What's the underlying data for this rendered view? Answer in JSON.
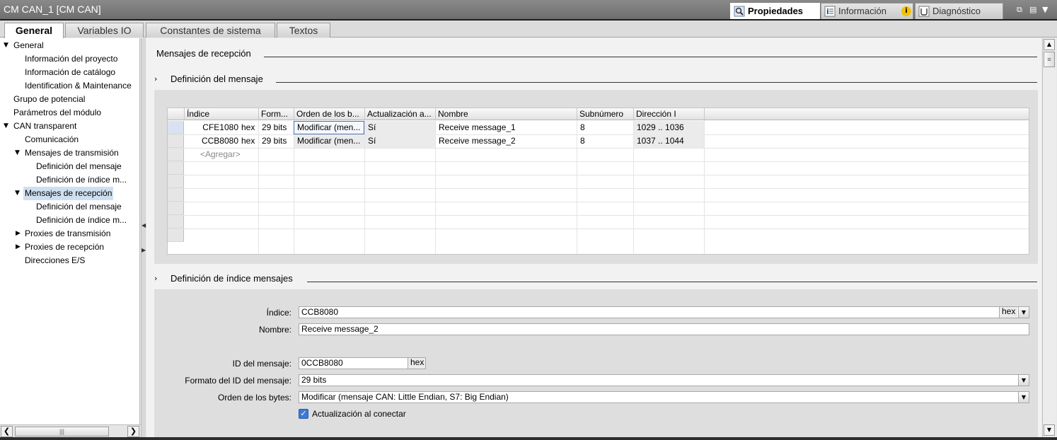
{
  "window": {
    "title": "CM CAN_1 [CM CAN]"
  },
  "inspector_tabs": [
    {
      "label": "Propiedades",
      "icon": "magnifier-icon",
      "active": true
    },
    {
      "label": "Información",
      "icon": "info-list-icon",
      "badge": "i"
    },
    {
      "label": "Diagnóstico",
      "icon": "diagnostics-icon"
    }
  ],
  "tabs": [
    "General",
    "Variables IO",
    "Constantes de sistema",
    "Textos"
  ],
  "active_tab": "General",
  "nav": [
    {
      "label": "General",
      "expanded": true
    },
    {
      "label": "Información del proyecto"
    },
    {
      "label": "Información de catálogo"
    },
    {
      "label": "Identification & Maintenance"
    },
    {
      "label": "Grupo de potencial"
    },
    {
      "label": "Parámetros del módulo"
    },
    {
      "label": "CAN transparent",
      "expanded": true
    },
    {
      "label": "Comunicación"
    },
    {
      "label": "Mensajes de transmisión",
      "expanded": true
    },
    {
      "label": "Definición del mensaje"
    },
    {
      "label": "Definición de índice m..."
    },
    {
      "label": "Mensajes de recepción",
      "expanded": true,
      "selected": true
    },
    {
      "label": "Definición del mensaje"
    },
    {
      "label": "Definición de índice m..."
    },
    {
      "label": "Proxies de transmisión",
      "expanded": false
    },
    {
      "label": "Proxies de recepción",
      "expanded": false
    },
    {
      "label": "Direcciones E/S"
    }
  ],
  "content": {
    "heading": "Mensajes de recepción",
    "section1": "Definición del mensaje",
    "section2": "Definición de índice mensajes"
  },
  "table": {
    "columns": [
      "Índice",
      "Form...",
      "Orden de los b...",
      "Actualización a...",
      "Nombre",
      "Subnúmero",
      "Dirección I"
    ],
    "rows": [
      {
        "index": "CFE1080",
        "index_fmt": "hex",
        "format": "29 bits",
        "byte_order": "Modificar (men...",
        "update": "Sí",
        "name": "Receive message_1",
        "subnumber": "8",
        "address": "1029 .. 1036"
      },
      {
        "index": "CCB8080",
        "index_fmt": "hex",
        "format": "29 bits",
        "byte_order": "Modificar (men...",
        "update": "Sí",
        "name": "Receive message_2",
        "subnumber": "8",
        "address": "1037 .. 1044"
      }
    ],
    "add_placeholder": "<Agregar>"
  },
  "form": {
    "index_label": "Índice:",
    "index_value": "CCB8080",
    "index_unit": "hex",
    "name_label": "Nombre:",
    "name_value": "Receive message_2",
    "msgid_label": "ID del mensaje:",
    "msgid_value": "0CCB8080",
    "msgid_unit": "hex",
    "idformat_label": "Formato del ID del mensaje:",
    "idformat_value": "29 bits",
    "byteorder_label": "Orden de los bytes:",
    "byteorder_value": "Modificar (mensaje CAN: Little Endian, S7: Big Endian)",
    "update_label": "Actualización al conectar",
    "update_checked": true
  }
}
